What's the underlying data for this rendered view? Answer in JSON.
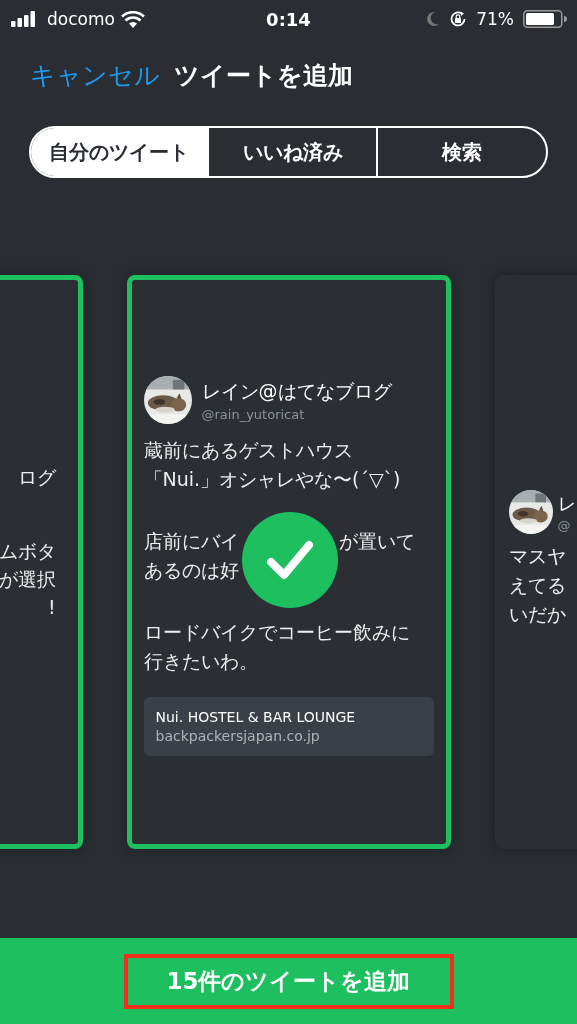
{
  "status_bar": {
    "carrier": "docomo",
    "time": "0:14",
    "battery": "71%"
  },
  "header": {
    "cancel": "キャンセル",
    "title": "ツイートを追加"
  },
  "tabs": [
    {
      "label": "自分のツイート",
      "selected": true
    },
    {
      "label": "いいね済み",
      "selected": false
    },
    {
      "label": "検索",
      "selected": false
    }
  ],
  "cards": [
    {
      "kind": "left",
      "selected": true,
      "name": "ログ",
      "lines": [
        "ムボタ",
        "が選択",
        "!"
      ]
    },
    {
      "kind": "center",
      "selected": true,
      "name": "レイン@はてなブログ",
      "handle": "@rain_yutoricat",
      "paragraphs": [
        [
          [
            "蔵前にあるゲストハウス"
          ],
          [
            "「Nui.」オシャレやな〜(´▽`)"
          ]
        ],
        [
          [
            "店前にバイ",
            "が置いて"
          ],
          [
            "あるのは好"
          ]
        ],
        [
          [
            "ロードバイクでコーヒー飲みに"
          ],
          [
            "行きたいわ。"
          ]
        ]
      ],
      "link": {
        "title": "Nui. HOSTEL & BAR LOUNGE",
        "domain": "backpackersjapan.co.jp"
      }
    },
    {
      "kind": "right",
      "selected": false,
      "name": "レ",
      "handle": "@",
      "lines": [
        "マスヤ",
        "えてる",
        "いだか"
      ]
    }
  ],
  "add_button": {
    "label": "15件のツイートを追加",
    "highlighted": true
  }
}
